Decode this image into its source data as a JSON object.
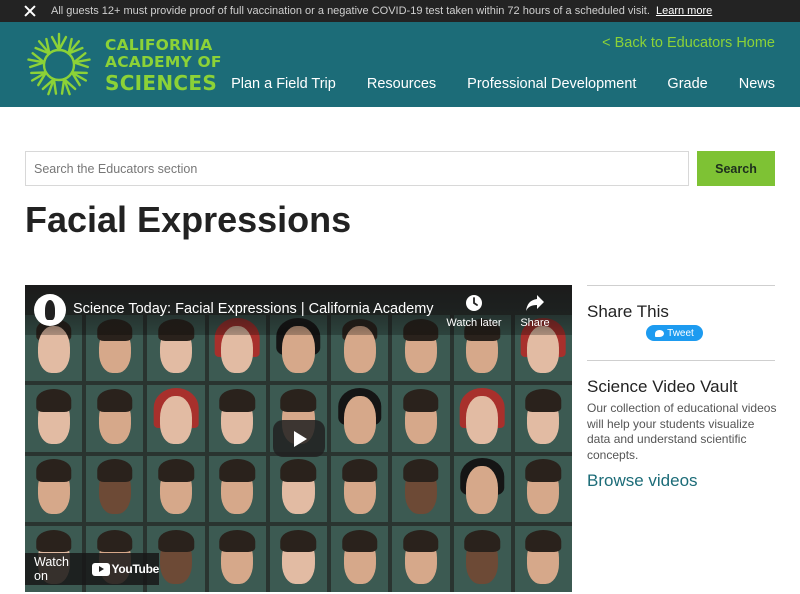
{
  "alert": {
    "message": "All guests 12+ must provide proof of full vaccination or a negative COVID-19 test taken within 72 hours of a scheduled visit.",
    "link": "Learn more"
  },
  "header": {
    "logo_line1": "CALIFORNIA",
    "logo_line2": "ACADEMY OF",
    "logo_line3": "SCIENCES",
    "back_link": "< Back to Educators Home",
    "nav": [
      "Plan a Field Trip",
      "Resources",
      "Professional Development",
      "Grade",
      "News"
    ]
  },
  "search": {
    "placeholder": "Search the Educators section",
    "button": "Search"
  },
  "page": {
    "title": "Facial Expressions"
  },
  "video": {
    "title": "Science Today: Facial Expressions | California Academy ...",
    "watch_later": "Watch later",
    "share": "Share",
    "watch_on": "Watch on",
    "youtube": "YouTube"
  },
  "sidebar": {
    "share_heading": "Share This",
    "tweet": "Tweet",
    "vault_heading": "Science Video Vault",
    "vault_desc": "Our collection of educational videos will help your students visualize data and understand scientific concepts.",
    "browse": "Browse videos"
  },
  "colors": {
    "header_bg": "#1c6c78",
    "brand_green": "#8cd237",
    "search_button": "#7ec234",
    "alert_bg": "#232323",
    "tweet_blue": "#1d9bf0"
  }
}
